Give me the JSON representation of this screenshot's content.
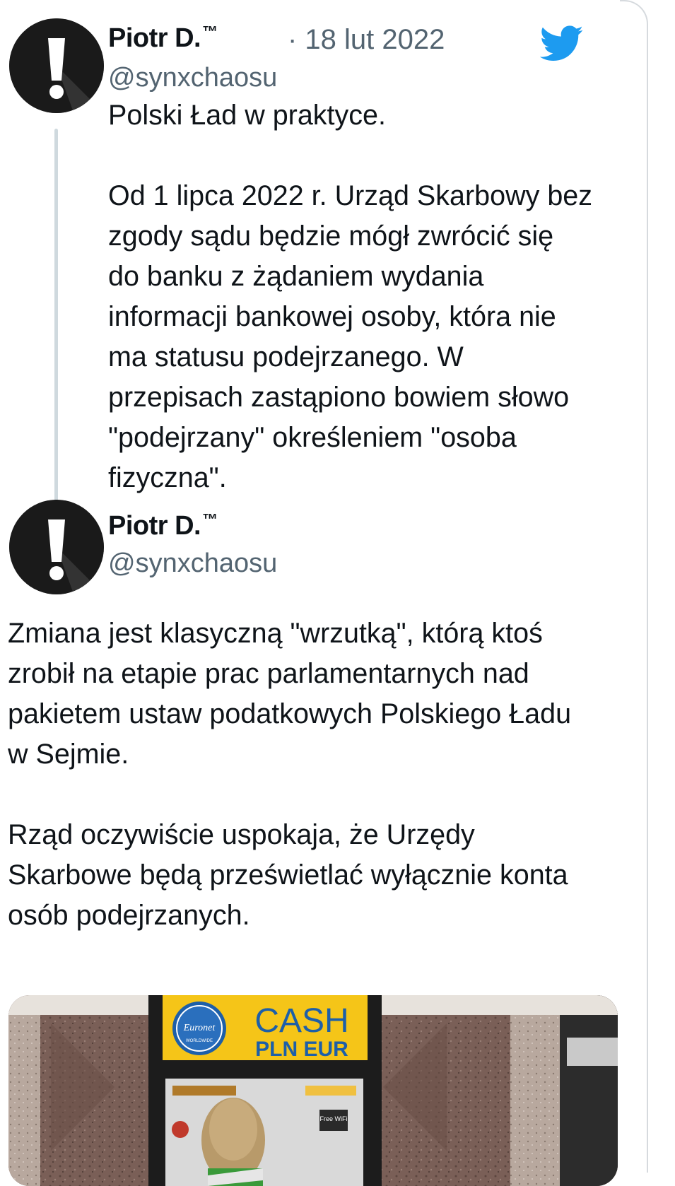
{
  "tweet1": {
    "author_name": "Piotr D.",
    "trademark": "™",
    "handle": "@synxchaosu",
    "date": "· 18 lut 2022",
    "text": "Polski Ład w praktyce.\n\nOd 1 lipca 2022 r. Urząd Skarbowy bez\nzgody sądu będzie mógł zwrócić się\ndo banku z żądaniem wydania\ninformacji bankowej osoby, która nie\nma statusu podejrzanego. W\nprzepisach zastąpiono bowiem słowo\n\"podejrzany\" określeniem \"osoba\nfizyczna\"."
  },
  "tweet2": {
    "author_name": "Piotr D.",
    "trademark": "™",
    "handle": "@synxchaosu",
    "text": "Zmiana jest klasyczną \"wrzutką\", którą ktoś\nzrobił na etapie prac parlamentarnych nad\npakietem ustaw podatkowych Polskiego Ładu\nw Sejmie.\n\nRząd oczywiście uspokaja, że Urzędy\nSkarbowe będą prześwietlać wyłącznie konta\nosób podejrzanych."
  },
  "media": {
    "brand": "Euronet",
    "brand_sub": "WORLDWIDE",
    "sign_main": "CASH",
    "sign_sub": "PLN EUR",
    "wifi": "Free WiFi"
  },
  "colors": {
    "twitter_blue": "#1d9bf0",
    "avatar_dark": "#1a1a1a",
    "thread_line": "#cfd9de",
    "secondary_text": "#536471",
    "atm_sign_yellow": "#f5c518"
  },
  "icons": {
    "avatar": "exclamation-mark-icon",
    "source": "twitter-bird-icon"
  }
}
